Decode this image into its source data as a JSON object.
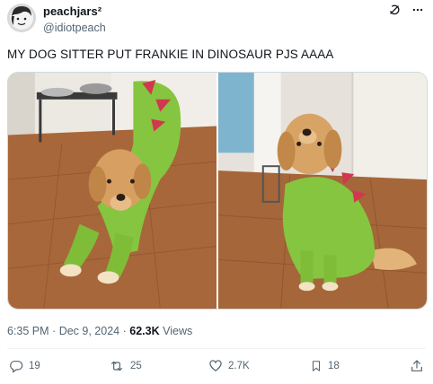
{
  "user": {
    "display_name": "peachjars²",
    "handle": "@idiotpeach"
  },
  "tweet": {
    "text": "MY DOG SITTER PUT FRANKIE IN DINOSAUR PJS AAAA",
    "time": "6:35 PM",
    "date": "Dec 9, 2024",
    "views_count": "62.3K",
    "views_label": "Views",
    "separator": "·"
  },
  "icons": {
    "grok": "grok-icon",
    "more": "more-icon",
    "reply": "reply-icon",
    "retweet": "retweet-icon",
    "like": "like-icon",
    "bookmark": "bookmark-icon",
    "share": "share-icon"
  },
  "actions": {
    "replies": "19",
    "retweets": "25",
    "likes": "2.7K",
    "bookmarks": "18"
  },
  "colors": {
    "text_primary": "#0f1419",
    "text_secondary": "#536471",
    "border": "#cfd9de"
  }
}
